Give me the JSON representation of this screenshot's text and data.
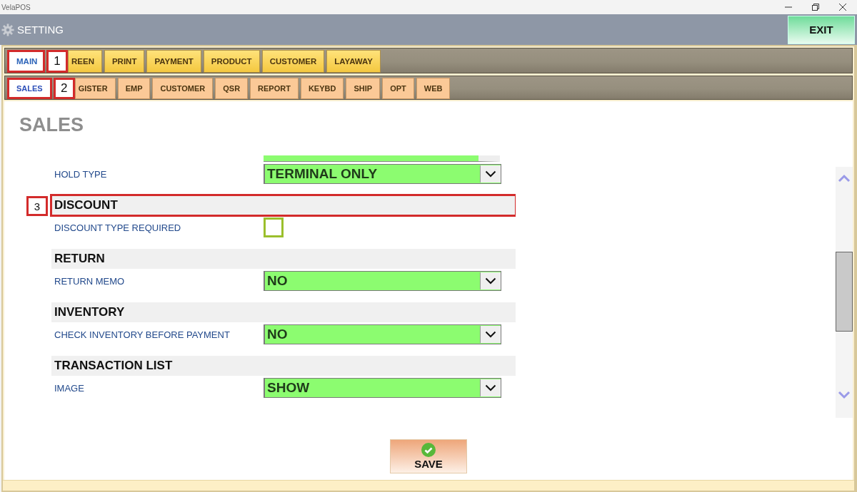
{
  "window": {
    "title": "VelaPOS"
  },
  "header": {
    "title": "SETTING",
    "exit_button": "EXIT"
  },
  "main_tabs": [
    {
      "label": "MAIN",
      "selected": true,
      "callout": "1"
    },
    {
      "label": "REEN",
      "selected": false
    },
    {
      "label": "PRINT",
      "selected": false
    },
    {
      "label": "PAYMENT",
      "selected": false
    },
    {
      "label": "PRODUCT",
      "selected": false
    },
    {
      "label": "CUSTOMER",
      "selected": false
    },
    {
      "label": "LAYAWAY",
      "selected": false
    }
  ],
  "sub_tabs": [
    {
      "label": "SALES",
      "selected": true,
      "callout": "2"
    },
    {
      "label": "GISTER",
      "selected": false
    },
    {
      "label": "EMP",
      "selected": false
    },
    {
      "label": "CUSTOMER",
      "selected": false
    },
    {
      "label": "QSR",
      "selected": false
    },
    {
      "label": "REPORT",
      "selected": false
    },
    {
      "label": "KEYBD",
      "selected": false
    },
    {
      "label": "SHIP",
      "selected": false
    },
    {
      "label": "OPT",
      "selected": false
    },
    {
      "label": "WEB",
      "selected": false
    }
  ],
  "page_title": "SALES",
  "settings": [
    {
      "kind": "dropdown",
      "label": "HOLD TYPE",
      "value": "TERMINAL ONLY"
    },
    {
      "kind": "section",
      "label": "DISCOUNT",
      "callout": "3"
    },
    {
      "kind": "checkbox",
      "label": "DISCOUNT TYPE REQUIRED",
      "checked": false
    },
    {
      "kind": "section",
      "label": "RETURN"
    },
    {
      "kind": "dropdown",
      "label": "RETURN MEMO",
      "value": "NO"
    },
    {
      "kind": "section",
      "label": "INVENTORY"
    },
    {
      "kind": "dropdown",
      "label": "CHECK INVENTORY BEFORE PAYMENT",
      "value": "NO"
    },
    {
      "kind": "section",
      "label": "TRANSACTION LIST"
    },
    {
      "kind": "dropdown",
      "label": "IMAGE",
      "value": "SHOW"
    }
  ],
  "save_button": "SAVE"
}
